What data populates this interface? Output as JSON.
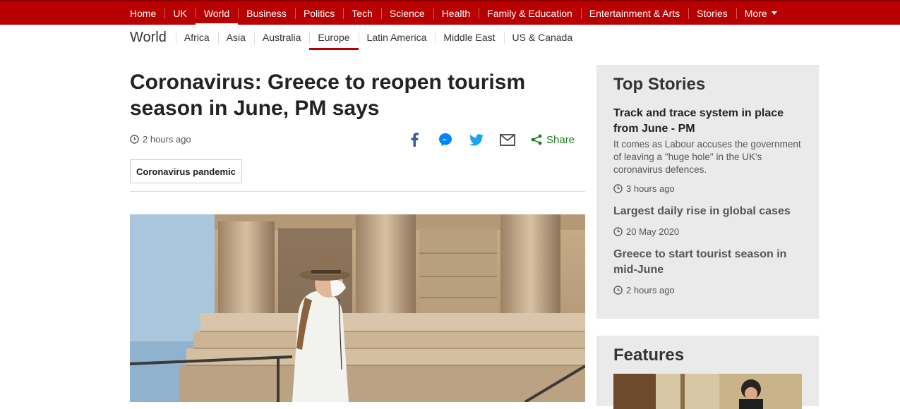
{
  "topnav": {
    "items": [
      {
        "label": "Home"
      },
      {
        "label": "UK"
      },
      {
        "label": "World"
      },
      {
        "label": "Business"
      },
      {
        "label": "Politics"
      },
      {
        "label": "Tech"
      },
      {
        "label": "Science"
      },
      {
        "label": "Health"
      },
      {
        "label": "Family & Education"
      },
      {
        "label": "Entertainment & Arts"
      },
      {
        "label": "Stories"
      },
      {
        "label": "More"
      }
    ],
    "active": "World"
  },
  "subnav": {
    "section": "World",
    "items": [
      {
        "label": "Africa"
      },
      {
        "label": "Asia"
      },
      {
        "label": "Australia"
      },
      {
        "label": "Europe"
      },
      {
        "label": "Latin America"
      },
      {
        "label": "Middle East"
      },
      {
        "label": "US & Canada"
      }
    ],
    "active": "Europe"
  },
  "article": {
    "headline": "Coronavirus: Greece to reopen tourism season in June, PM says",
    "timestamp": "2 hours ago",
    "share_label": "Share",
    "tag": "Coronavirus pandemic"
  },
  "top_stories": {
    "title": "Top Stories",
    "stories": [
      {
        "title": "Track and trace system in place from June - PM",
        "summary": "It comes as Labour accuses the government of leaving a \"huge hole\" in the UK's coronavirus defences.",
        "time": "3 hours ago"
      },
      {
        "title": "Largest daily rise in global cases",
        "time": "20 May 2020"
      },
      {
        "title": "Greece to start tourist season in mid-June",
        "time": "2 hours ago"
      }
    ]
  },
  "features": {
    "title": "Features"
  },
  "colors": {
    "brand_red": "#b80000",
    "share_green": "#1a7f1a",
    "sidebar_bg": "#eaeaea"
  }
}
